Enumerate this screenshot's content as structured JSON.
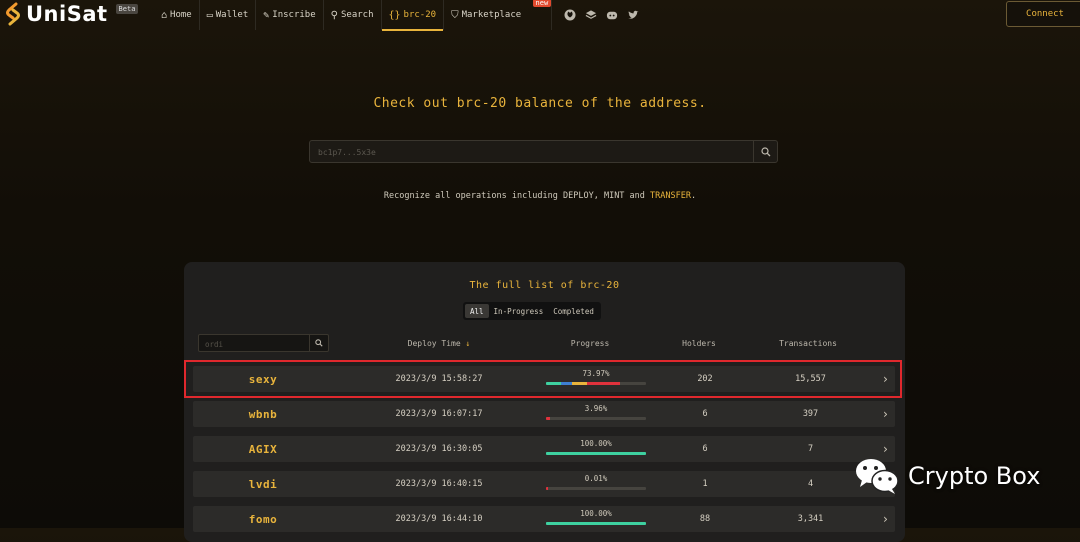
{
  "brand": {
    "name": "UniSat",
    "badge": "Beta"
  },
  "nav": {
    "items": [
      {
        "label": "Home",
        "icon": "home-icon",
        "glyph": "⌂"
      },
      {
        "label": "Wallet",
        "icon": "wallet-icon",
        "glyph": "▭"
      },
      {
        "label": "Inscribe",
        "icon": "pencil-icon",
        "glyph": "✎"
      },
      {
        "label": "Search",
        "icon": "search-icon",
        "glyph": "⚲"
      },
      {
        "label": "brc-20",
        "icon": "braces-icon",
        "glyph": "{}"
      },
      {
        "label": "Marketplace",
        "icon": "bag-icon",
        "glyph": "⛉"
      }
    ],
    "new_badge": "new",
    "socials": [
      "github-icon",
      "stack-icon",
      "discord-icon",
      "twitter-icon"
    ],
    "connect_label": "Connect"
  },
  "hero": {
    "title": "Check out brc-20 balance of the address.",
    "address_placeholder": "bc1p7...5x3e",
    "recognize_prefix": "Recognize all operations including DEPLOY, MINT and ",
    "recognize_highlight": "TRANSFER",
    "recognize_suffix": "."
  },
  "list": {
    "title": "The full list of brc-20",
    "tabs": [
      "All",
      "In-Progress",
      "Completed"
    ],
    "active_tab": "All",
    "filter_placeholder": "ordi",
    "columns": {
      "deploy_time": "Deploy Time",
      "sort_arrow": "↓",
      "progress": "Progress",
      "holders": "Holders",
      "transactions": "Transactions"
    },
    "rows": [
      {
        "ticker": "sexy",
        "deploy_time": "2023/3/9 15:58:27",
        "progress_label": "73.97%",
        "progress": 73.97,
        "holders": "202",
        "transactions": "15,557"
      },
      {
        "ticker": "wbnb",
        "deploy_time": "2023/3/9 16:07:17",
        "progress_label": "3.96%",
        "progress": 3.96,
        "holders": "6",
        "transactions": "397"
      },
      {
        "ticker": "AGIX",
        "deploy_time": "2023/3/9 16:30:05",
        "progress_label": "100.00%",
        "progress": 100,
        "holders": "6",
        "transactions": "7"
      },
      {
        "ticker": "lvdi",
        "deploy_time": "2023/3/9 16:40:15",
        "progress_label": "0.01%",
        "progress": 0.01,
        "holders": "1",
        "transactions": "4"
      },
      {
        "ticker": "fomo",
        "deploy_time": "2023/3/9 16:44:10",
        "progress_label": "100.00%",
        "progress": 100,
        "holders": "88",
        "transactions": "3,341"
      }
    ]
  },
  "watermark": {
    "text": "Crypto Box"
  },
  "colors": {
    "accent": "#e9b43c",
    "progress_full": "#3ed1a0",
    "progress_low": "#e0323c",
    "highlight_border": "#e0282d"
  }
}
